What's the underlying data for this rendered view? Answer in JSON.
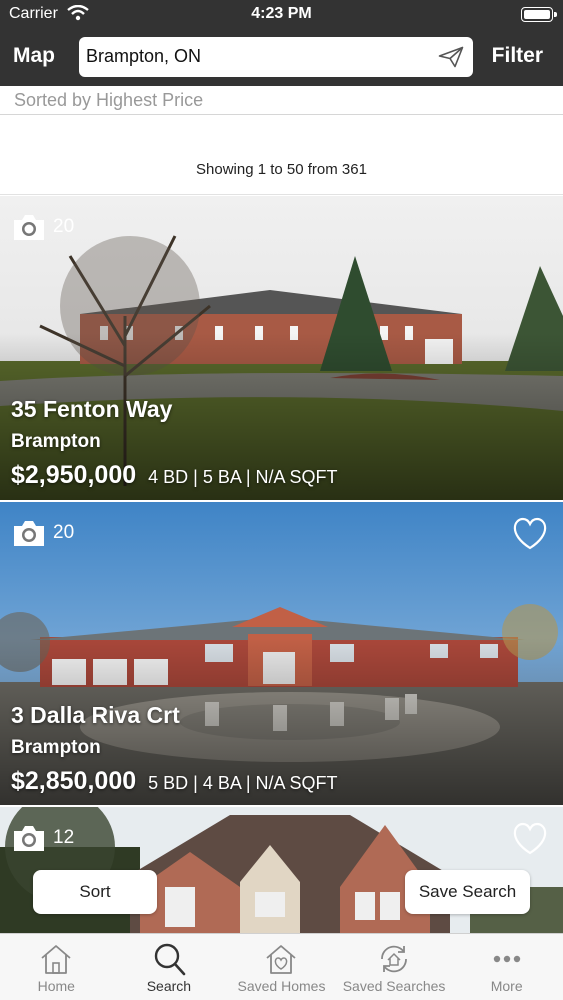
{
  "status_bar": {
    "carrier": "Carrier",
    "time": "4:23 PM"
  },
  "nav": {
    "map_label": "Map",
    "search_value": "Brampton, ON",
    "filter_label": "Filter"
  },
  "sort_label": "Sorted by Highest Price",
  "results_count": "Showing 1 to 50 from 361",
  "listings": [
    {
      "photo_count": "20",
      "address": "35 Fenton Way",
      "city": "Brampton",
      "price": "$2,950,000",
      "specs": "4 BD | 5 BA | N/A SQFT"
    },
    {
      "photo_count": "20",
      "address": "3 Dalla Riva Crt",
      "city": "Brampton",
      "price": "$2,850,000",
      "specs": "5 BD | 4 BA | N/A SQFT"
    },
    {
      "photo_count": "12"
    }
  ],
  "buttons": {
    "sort": "Sort",
    "save_search": "Save Search"
  },
  "tabs": [
    {
      "label": "Home",
      "icon": "home-icon"
    },
    {
      "label": "Search",
      "icon": "search-icon"
    },
    {
      "label": "Saved Homes",
      "icon": "saved-home-heart-icon"
    },
    {
      "label": "Saved Searches",
      "icon": "saved-search-refresh-icon"
    },
    {
      "label": "More",
      "icon": "more-dots-icon"
    }
  ],
  "colors": {
    "nav_bg": "#333333",
    "tab_active": "#333333",
    "tab_inactive": "#888888"
  }
}
